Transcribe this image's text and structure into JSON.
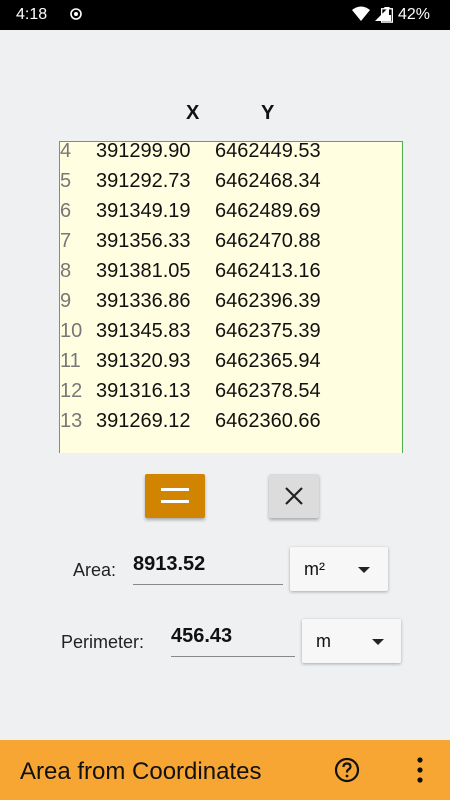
{
  "status_bar": {
    "time": "4:18",
    "battery": "42%"
  },
  "columns": {
    "x": "X",
    "y": "Y"
  },
  "rows": [
    {
      "index": "4",
      "x": "391299.90",
      "y": "6462449.53"
    },
    {
      "index": "5",
      "x": "391292.73",
      "y": "6462468.34"
    },
    {
      "index": "6",
      "x": "391349.19",
      "y": "6462489.69"
    },
    {
      "index": "7",
      "x": "391356.33",
      "y": "6462470.88"
    },
    {
      "index": "8",
      "x": "391381.05",
      "y": "6462413.16"
    },
    {
      "index": "9",
      "x": "391336.86",
      "y": "6462396.39"
    },
    {
      "index": "10",
      "x": "391345.83",
      "y": "6462375.39"
    },
    {
      "index": "11",
      "x": "391320.93",
      "y": "6462365.94"
    },
    {
      "index": "12",
      "x": "391316.13",
      "y": "6462378.54"
    },
    {
      "index": "13",
      "x": "391269.12",
      "y": "6462360.66"
    }
  ],
  "area": {
    "label": "Area:",
    "value": "8913.52",
    "unit": "m²"
  },
  "perimeter": {
    "label": "Perimeter:",
    "value": "456.43",
    "unit": "m"
  },
  "app_bar": {
    "title": "Area from Coordinates"
  },
  "icons": {
    "calculate": "equals-icon",
    "clear": "close-icon",
    "help": "help-circle-icon",
    "menu": "more-vert-icon"
  },
  "colors": {
    "accent": "#f7a634",
    "calculate_button": "#d18400",
    "input_background": "#fffee1",
    "input_border": "#4caf50"
  }
}
